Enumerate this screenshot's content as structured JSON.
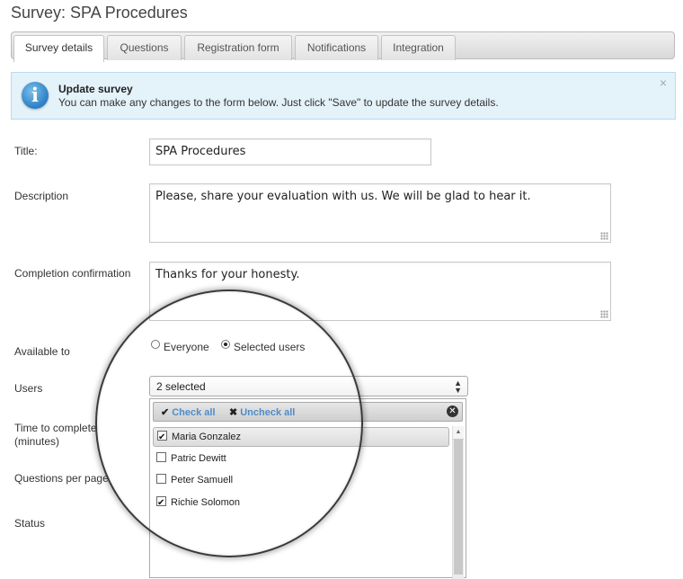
{
  "page": {
    "title": "Survey: SPA Procedures"
  },
  "tabs": [
    {
      "label": "Survey details",
      "active": true
    },
    {
      "label": "Questions",
      "active": false
    },
    {
      "label": "Registration form",
      "active": false
    },
    {
      "label": "Notifications",
      "active": false
    },
    {
      "label": "Integration",
      "active": false
    }
  ],
  "info": {
    "icon": "info-icon",
    "title": "Update survey",
    "text": "You can make any changes to the form below. Just click \"Save\" to update the survey details.",
    "close": "×"
  },
  "form": {
    "title_label": "Title:",
    "title_value": "SPA Procedures",
    "description_label": "Description",
    "description_value": "Please, share your evaluation with us. We will be glad to hear it.",
    "confirmation_label": "Completion confirmation",
    "confirmation_value": "Thanks for your honesty.",
    "available_label": "Available to",
    "available_options": [
      {
        "label": "Everyone",
        "checked": false
      },
      {
        "label": "Selected users",
        "checked": true
      }
    ],
    "users_label": "Users",
    "time_label_line1": "Time to complete",
    "time_label_line2": "(minutes)",
    "questions_label": "Questions per page",
    "status_label": "Status"
  },
  "users_select": {
    "value": "2 selected",
    "check_all": "Check all",
    "uncheck_all": "Uncheck all",
    "options": [
      {
        "label": "Maria Gonzalez",
        "checked": true,
        "highlighted": true
      },
      {
        "label": "Patric Dewitt",
        "checked": false,
        "highlighted": false
      },
      {
        "label": "Peter Samuell",
        "checked": false,
        "highlighted": false
      },
      {
        "label": "Richie Solomon",
        "checked": true,
        "highlighted": false
      }
    ]
  }
}
